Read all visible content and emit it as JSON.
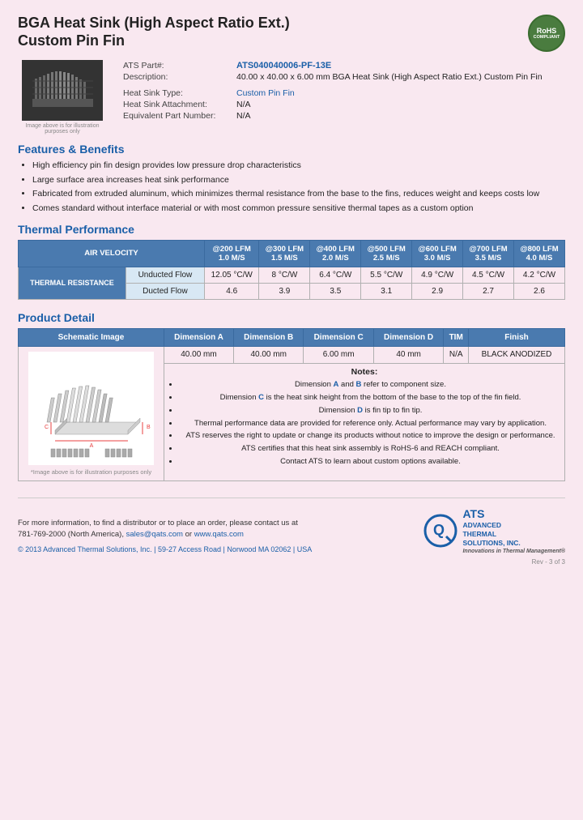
{
  "header": {
    "title_line1": "BGA Heat Sink (High Aspect Ratio Ext.)",
    "title_line2": "Custom Pin Fin",
    "rohs": "RoHS",
    "compliant": "COMPLIANT"
  },
  "specs": {
    "part_label": "ATS Part#:",
    "part_number": "ATS040040006-PF-13E",
    "desc_label": "Description:",
    "description": "40.00 x 40.00 x 6.00 mm  BGA Heat Sink (High Aspect Ratio Ext.) Custom Pin Fin",
    "type_label": "Heat Sink Type:",
    "type_value": "Custom Pin Fin",
    "attachment_label": "Heat Sink Attachment:",
    "attachment_value": "N/A",
    "equiv_label": "Equivalent Part Number:",
    "equiv_value": "N/A"
  },
  "image_caption": "Image above is for illustration purposes only",
  "features": {
    "section_title": "Features & Benefits",
    "items": [
      "High efficiency pin fin design provides low pressure drop characteristics",
      "Large surface area increases heat sink performance",
      "Fabricated from extruded aluminum, which minimizes thermal resistance from the base to the fins, reduces weight and keeps costs low",
      "Comes standard without interface material or with most common pressure sensitive thermal tapes as a custom option"
    ]
  },
  "thermal": {
    "section_title": "Thermal Performance",
    "col_header": "AIR VELOCITY",
    "columns": [
      {
        "lfm": "@200 LFM",
        "ms": "1.0 M/S"
      },
      {
        "lfm": "@300 LFM",
        "ms": "1.5 M/S"
      },
      {
        "lfm": "@400 LFM",
        "ms": "2.0 M/S"
      },
      {
        "lfm": "@500 LFM",
        "ms": "2.5 M/S"
      },
      {
        "lfm": "@600 LFM",
        "ms": "3.0 M/S"
      },
      {
        "lfm": "@700 LFM",
        "ms": "3.5 M/S"
      },
      {
        "lfm": "@800 LFM",
        "ms": "4.0 M/S"
      }
    ],
    "row_label": "THERMAL RESISTANCE",
    "rows": [
      {
        "sub_label": "Unducted Flow",
        "values": [
          "12.05 °C/W",
          "8 °C/W",
          "6.4 °C/W",
          "5.5 °C/W",
          "4.9 °C/W",
          "4.5 °C/W",
          "4.2 °C/W"
        ]
      },
      {
        "sub_label": "Ducted Flow",
        "values": [
          "4.6",
          "3.9",
          "3.5",
          "3.1",
          "2.9",
          "2.7",
          "2.6"
        ]
      }
    ]
  },
  "product_detail": {
    "section_title": "Product Detail",
    "columns": [
      "Schematic Image",
      "Dimension A",
      "Dimension B",
      "Dimension C",
      "Dimension D",
      "TIM",
      "Finish"
    ],
    "dims": [
      "40.00 mm",
      "40.00 mm",
      "6.00 mm",
      "40 mm",
      "N/A",
      "BLACK ANODIZED"
    ],
    "schematic_caption": "*Image above is for illustration purposes only",
    "notes_title": "Notes:",
    "notes": [
      "Dimension A and B refer to component size.",
      "Dimension C is the heat sink height from the bottom of the base to the top of the fin field.",
      "Dimension D is fin tip to fin tip.",
      "Thermal performance data are provided for reference only. Actual performance may vary by application.",
      "ATS reserves the right to update or change its products without notice to improve the design or performance.",
      "ATS certifies that this heat sink assembly is RoHS-6 and REACH compliant.",
      "Contact ATS to learn about custom options available."
    ],
    "notes_highlights": [
      "A",
      "B",
      "C",
      "D"
    ]
  },
  "footer": {
    "contact_text": "For more information, to find a distributor or to place an order, please contact us at",
    "phone": "781-769-2000 (North America),",
    "email": "sales@qats.com",
    "or": "or",
    "website": "www.qats.com",
    "copyright": "© 2013 Advanced Thermal Solutions, Inc.",
    "address": "59-27 Access Road  |  Norwood MA  02062  |  USA",
    "brand_line1": "ADVANCED",
    "brand_line2": "THERMAL",
    "brand_line3": "SOLUTIONS, INC.",
    "tagline": "Innovations in Thermal Management®",
    "page_num": "Rev - 3 of 3"
  }
}
